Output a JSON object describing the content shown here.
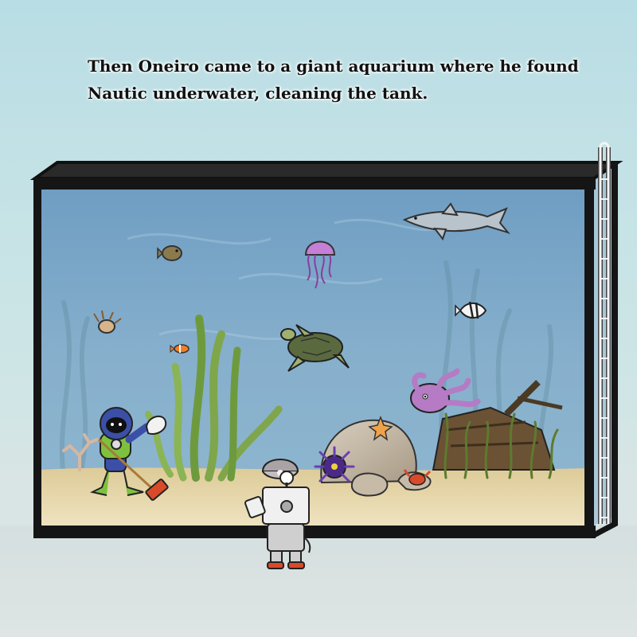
{
  "story": {
    "line1": "Then Oneiro came to a giant aquarium where he found",
    "line2": "Nautic underwater, cleaning the tank."
  },
  "colors": {
    "water": "#7fa8c8",
    "sand": "#e8d9ad",
    "frame": "#151515",
    "seaweed": "#7fa64a",
    "octopus": "#b57bc4"
  },
  "characters": [
    "Oneiro",
    "Nautic"
  ]
}
